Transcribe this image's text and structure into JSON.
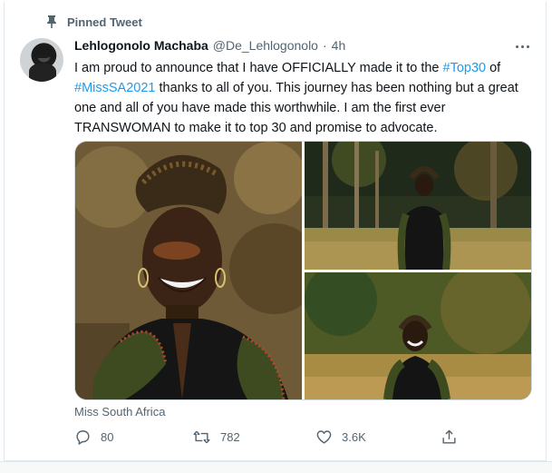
{
  "pinned_label": "Pinned Tweet",
  "author": {
    "name": "Lehlogonolo Machaba",
    "handle": "@De_Lehlogonolo",
    "separator": "·",
    "time": "4h"
  },
  "tweet": {
    "line1_pre": "I am proud to announce that I have OFFICIALLY made it to the ",
    "line1_tag": "#Top30",
    "line1_post": " of",
    "line2_tag": "#MissSA2021",
    "line2_post": " thanks to all of you. This journey has been nothing but a great",
    "line3": "one and all of you have made this worthwhile. I am the first ever",
    "line4": "TRANSWOMAN to make it to top 30 and promise to advocate."
  },
  "source": "Miss South Africa",
  "actions": {
    "replies": "80",
    "retweets": "782",
    "likes": "3.6K"
  },
  "colors": {
    "accent": "#1d9bf0",
    "secondary_text": "#536471"
  },
  "icons": {
    "pin": "pin-icon",
    "more": "more-icon",
    "reply": "reply-icon",
    "retweet": "retweet-icon",
    "like": "heart-icon",
    "share": "share-icon"
  }
}
